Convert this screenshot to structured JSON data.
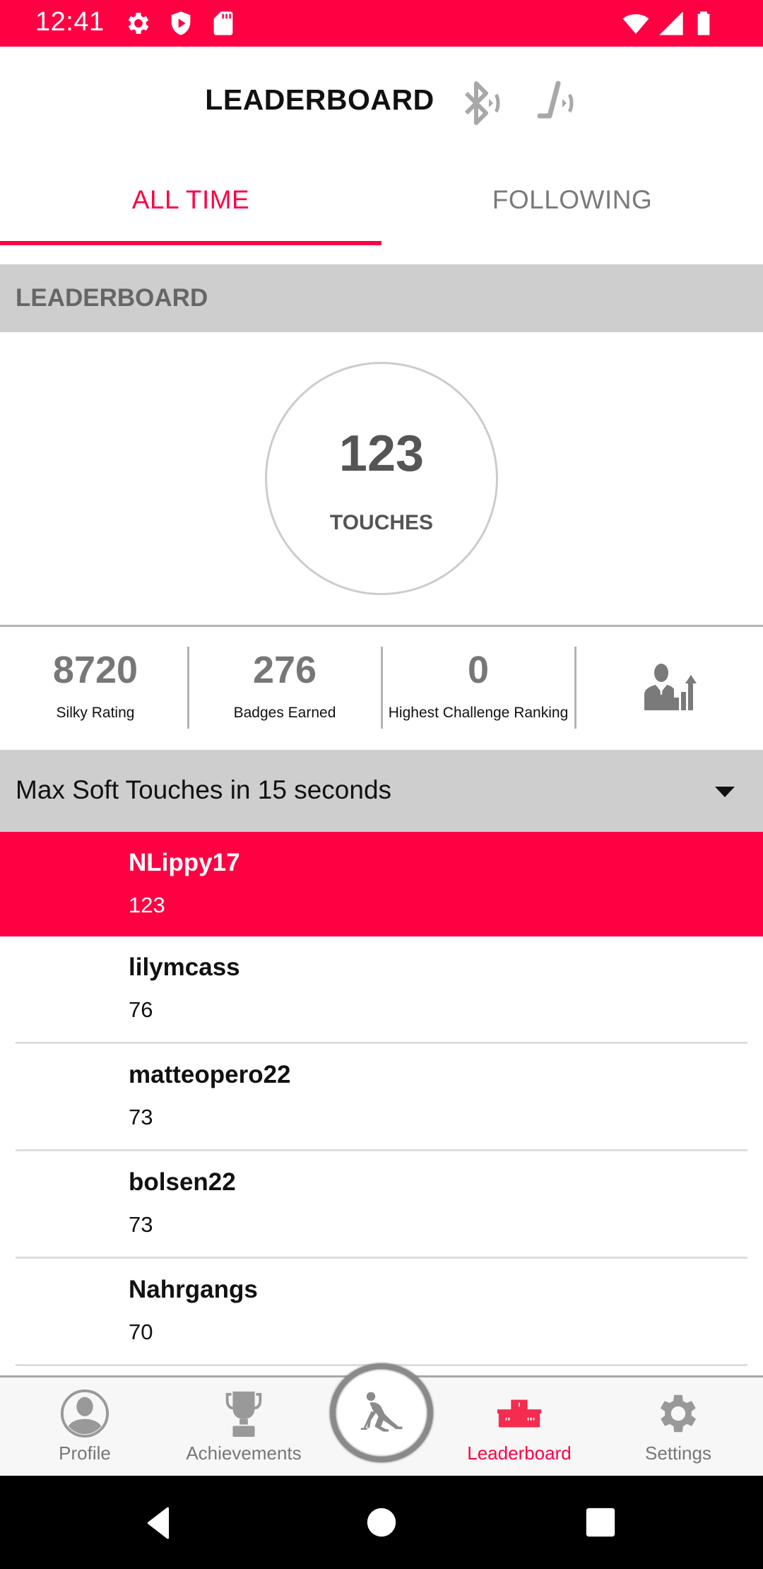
{
  "status_bar": {
    "time": "12:41",
    "left_icons": [
      "settings-gear-icon",
      "shield-play-icon",
      "sd-card-icon"
    ],
    "right_icons": [
      "wifi-icon",
      "cell-signal-icon",
      "battery-icon"
    ]
  },
  "header": {
    "title": "LEADERBOARD",
    "icons": [
      "bluetooth-icon",
      "hockey-stick-signal-icon"
    ]
  },
  "tabs": [
    {
      "label": "ALL TIME",
      "active": true
    },
    {
      "label": "FOLLOWING",
      "active": false
    }
  ],
  "section": {
    "title": "LEADERBOARD"
  },
  "score": {
    "value": "123",
    "label": "TOUCHES"
  },
  "stats": [
    {
      "value": "8720",
      "label": "Silky Rating"
    },
    {
      "value": "276",
      "label": "Badges Earned"
    },
    {
      "value": "0",
      "label": "Highest Challenge Ranking"
    }
  ],
  "stats_icon": "person-growth-chart-icon",
  "dropdown": {
    "selected": "Max Soft Touches in 15 seconds"
  },
  "leaderboard": [
    {
      "name": "NLippy17",
      "score": "123",
      "highlighted": true
    },
    {
      "name": "lilymcass",
      "score": "76",
      "highlighted": false
    },
    {
      "name": "matteopero22",
      "score": "73",
      "highlighted": false
    },
    {
      "name": "bolsen22",
      "score": "73",
      "highlighted": false
    },
    {
      "name": "Nahrgangs",
      "score": "70",
      "highlighted": false
    }
  ],
  "bottom_nav": [
    {
      "label": "Profile",
      "icon": "profile-icon",
      "active": false
    },
    {
      "label": "Achievements",
      "icon": "trophy-icon",
      "active": false
    },
    {
      "label": "",
      "icon": "hockey-player-icon",
      "active": false
    },
    {
      "label": "Leaderboard",
      "icon": "podium-icon",
      "active": true
    },
    {
      "label": "Settings",
      "icon": "settings-icon",
      "active": false
    }
  ],
  "colors": {
    "accent": "#ff0043",
    "section_bg": "#cfcecf",
    "muted_text": "#777777"
  }
}
